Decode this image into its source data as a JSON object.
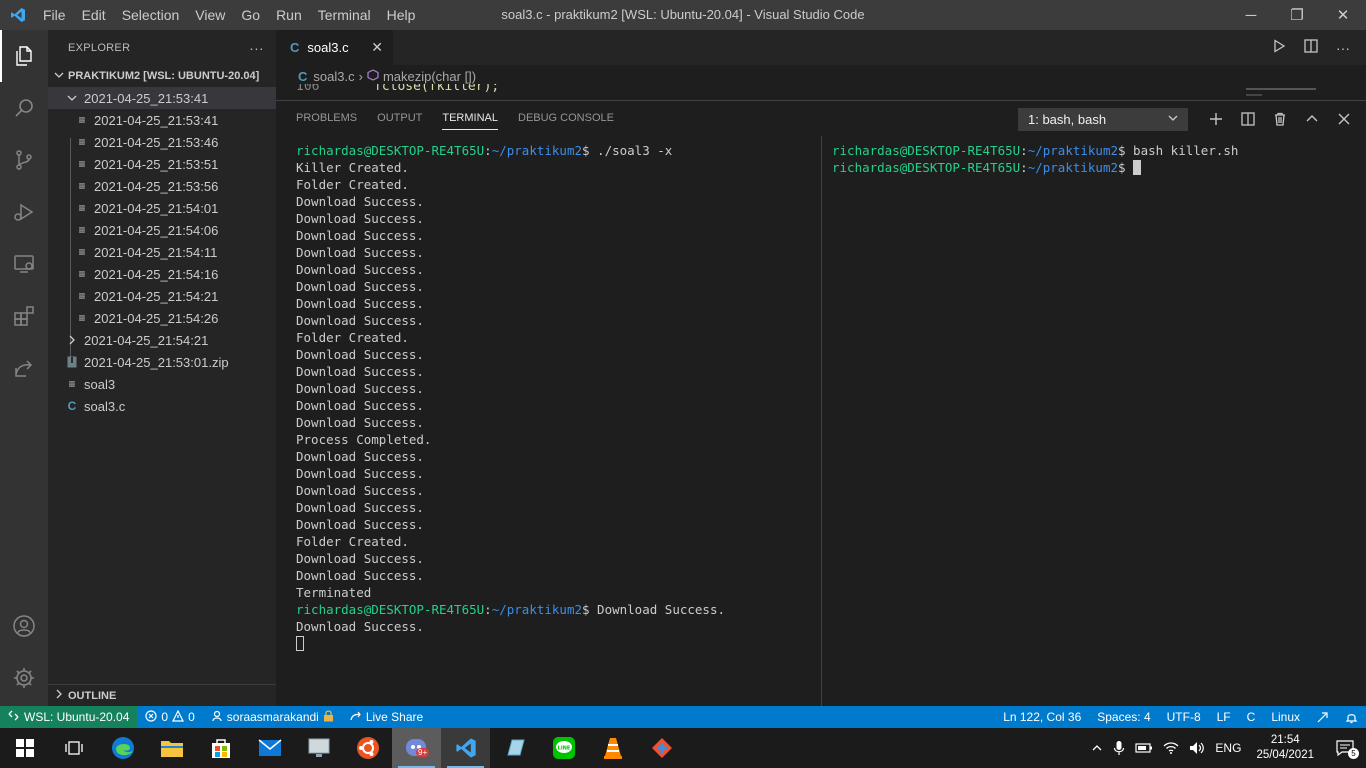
{
  "window": {
    "title": "soal3.c - praktikum2 [WSL: Ubuntu-20.04] - Visual Studio Code",
    "minimize": "─",
    "maximize": "❐",
    "close": "✕"
  },
  "menu": [
    "File",
    "Edit",
    "Selection",
    "View",
    "Go",
    "Run",
    "Terminal",
    "Help"
  ],
  "explorer": {
    "header": "EXPLORER",
    "more": "···",
    "root": "PRAKTIKUM2 [WSL: UBUNTU-20.04]",
    "open_folder": "2021-04-25_21:53:41",
    "children": [
      "2021-04-25_21:53:41",
      "2021-04-25_21:53:46",
      "2021-04-25_21:53:51",
      "2021-04-25_21:53:56",
      "2021-04-25_21:54:01",
      "2021-04-25_21:54:06",
      "2021-04-25_21:54:11",
      "2021-04-25_21:54:16",
      "2021-04-25_21:54:21",
      "2021-04-25_21:54:26"
    ],
    "closed_folder": "2021-04-25_21:54:21",
    "zip_file": "2021-04-25_21:53:01.zip",
    "binary_file": "soal3",
    "c_file": "soal3.c",
    "outline": "OUTLINE"
  },
  "editor": {
    "tab_label": "soal3.c",
    "tab_icon": "C",
    "breadcrumb_file": "soal3.c",
    "breadcrumb_symbol": "makezip(char [])",
    "line_number": "106",
    "line_code": "fclose(fkiller);"
  },
  "panel": {
    "tabs": [
      "PROBLEMS",
      "OUTPUT",
      "TERMINAL",
      "DEBUG CONSOLE"
    ],
    "terminal_select": "1: bash, bash",
    "prompt_user": "richardas@DESKTOP-RE4T65U",
    "prompt_path": "~/praktikum2",
    "left_command": " ./soal3 -x",
    "left_output": [
      "Killer Created.",
      "Folder Created.",
      "Download Success.",
      "Download Success.",
      "Download Success.",
      "Download Success.",
      "Download Success.",
      "Download Success.",
      "Download Success.",
      "Download Success.",
      "Folder Created.",
      "Download Success.",
      "Download Success.",
      "Download Success.",
      "Download Success.",
      "Download Success.",
      "Process Completed.",
      "Download Success.",
      "Download Success.",
      "Download Success.",
      "Download Success.",
      "Download Success.",
      "Folder Created.",
      "Download Success.",
      "Download Success.",
      "Terminated"
    ],
    "left_after_prompt": " Download Success.",
    "left_last_line": "Download Success.",
    "right_command": " bash killer.sh"
  },
  "status": {
    "remote": "WSL: Ubuntu-20.04",
    "errors": "0",
    "warnings": "0",
    "user": "soraasmarakandi",
    "live_share": "Live Share",
    "position": "Ln 122, Col 36",
    "spaces": "Spaces: 4",
    "encoding": "UTF-8",
    "eol": "LF",
    "language": "C",
    "os": "Linux"
  },
  "taskbar": {
    "lang": "ENG",
    "time": "21:54",
    "date": "25/04/2021",
    "notifications": "5",
    "discord_badge": "9+"
  },
  "colors": {
    "accent": "#007acc",
    "remote": "#16825d",
    "prompt_user": "#23d18b",
    "prompt_path": "#3b8eea"
  }
}
